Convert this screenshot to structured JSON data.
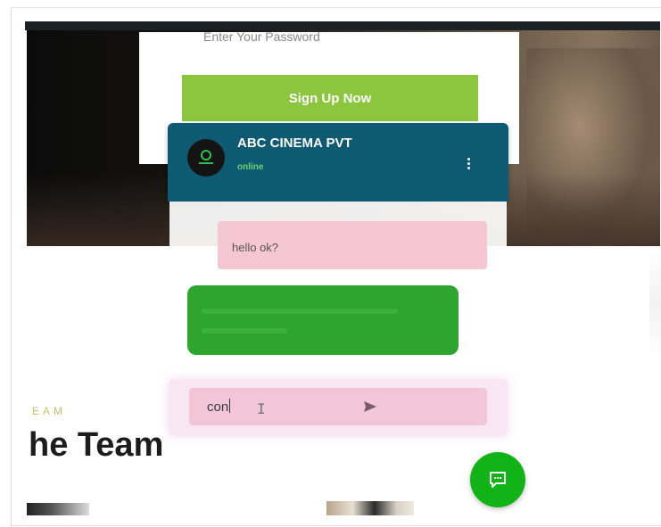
{
  "signup": {
    "password_placeholder": "Enter Your Password",
    "button_label": "Sign Up Now"
  },
  "chat": {
    "title": "ABC CINEMA PVT",
    "status": "online",
    "outgoing_message": "hello ok?",
    "input_value": "con",
    "colors": {
      "header": "#0e5a73",
      "incoming_bubble": "#2ea52e",
      "outgoing_bubble": "#f5c6d3",
      "fab": "#12b316"
    }
  },
  "team": {
    "eyebrow": "EAM",
    "title": "he Team"
  },
  "icons": {
    "menu": "vertical-dots-icon",
    "send": "send-icon",
    "fab": "chat-bubble-icon",
    "avatar": "company-logo-icon"
  }
}
